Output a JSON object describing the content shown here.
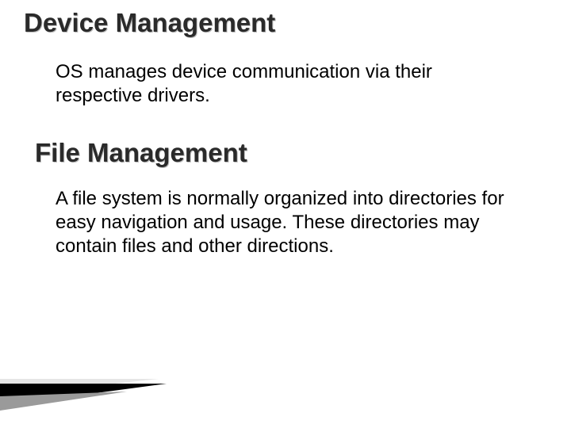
{
  "sections": [
    {
      "heading": "Device Management",
      "body": "OS manages device communication via their respective drivers."
    },
    {
      "heading": "File Management",
      "body": "A file system is normally organized into directories for easy navigation and usage. These directories may contain files and other directions."
    }
  ]
}
